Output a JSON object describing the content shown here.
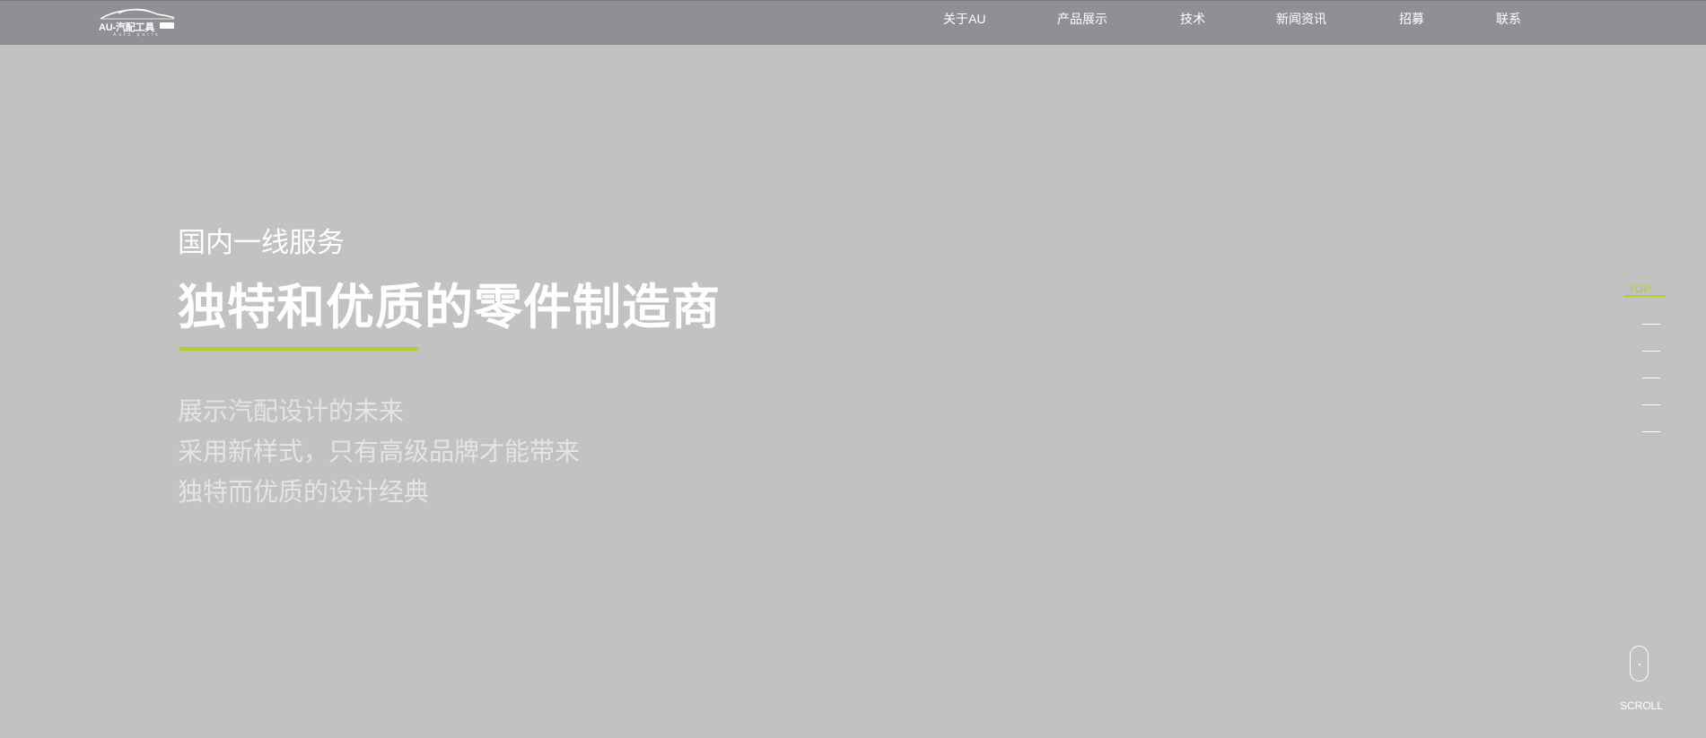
{
  "logo": {
    "name": "AU-汽配工具",
    "subtitle": "Auto parts"
  },
  "nav": {
    "items": [
      {
        "label": "关于AU"
      },
      {
        "label": "产品展示"
      },
      {
        "label": "技术"
      },
      {
        "label": "新闻资讯"
      },
      {
        "label": "招募"
      },
      {
        "label": "联系"
      }
    ]
  },
  "hero": {
    "kicker": "国内一线服务",
    "title": "独特和优质的零件制造商",
    "lines": [
      "展示汽配设计的未来",
      "采用新样式，只有高级品牌才能带来",
      "独特而优质的设计经典"
    ]
  },
  "side_nav": {
    "top_label": "TOP",
    "dash_count": 5
  },
  "scroll": {
    "label": "SCROLL"
  },
  "colors": {
    "accent": "#b3cc2c",
    "header_bg": "#8f9095",
    "page_bg": "#c2c2c2"
  }
}
